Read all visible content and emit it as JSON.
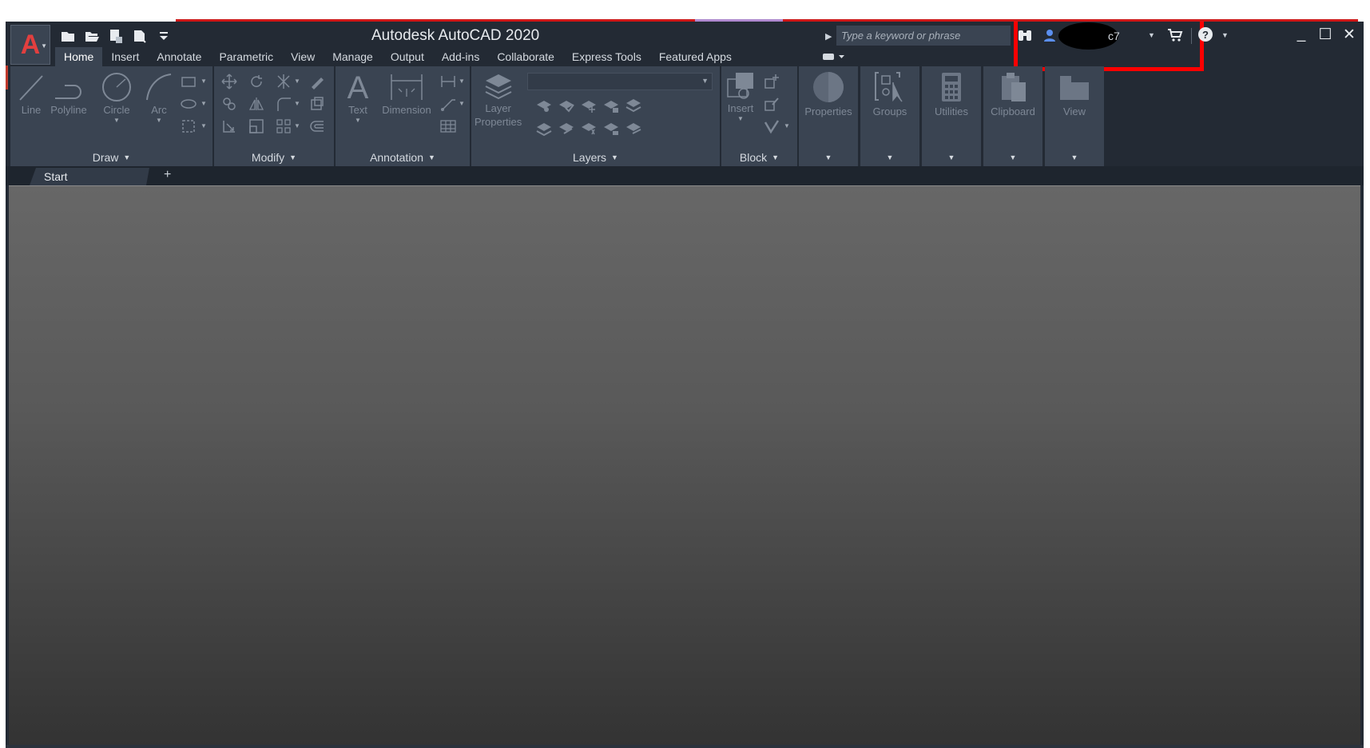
{
  "window": {
    "title": "Autodesk AutoCAD 2020"
  },
  "app_menu": {
    "letter": "A"
  },
  "quick_access": [
    "new-icon",
    "open-icon",
    "save-icon",
    "plot-icon",
    "customize-caret-icon"
  ],
  "search": {
    "placeholder": "Type a keyword or phrase"
  },
  "account": {
    "name_suffix": "c7"
  },
  "ribbon_tabs": [
    "Home",
    "Insert",
    "Annotate",
    "Parametric",
    "View",
    "Manage",
    "Output",
    "Add-ins",
    "Collaborate",
    "Express Tools",
    "Featured Apps"
  ],
  "active_tab": "Home",
  "panels": {
    "draw": {
      "title": "Draw",
      "tools": {
        "line": "Line",
        "polyline": "Polyline",
        "circle": "Circle",
        "arc": "Arc"
      }
    },
    "modify": {
      "title": "Modify"
    },
    "annotation": {
      "title": "Annotation",
      "tools": {
        "text": "Text",
        "dimension": "Dimension"
      }
    },
    "layers": {
      "title": "Layers",
      "tools": {
        "layer_properties_1": "Layer",
        "layer_properties_2": "Properties"
      }
    },
    "block": {
      "title": "Block",
      "tools": {
        "insert": "Insert"
      }
    },
    "properties": {
      "title": "Properties"
    },
    "groups": {
      "title": "Groups"
    },
    "utilities": {
      "title": "Utilities"
    },
    "clipboard": {
      "title": "Clipboard"
    },
    "view": {
      "title": "View"
    }
  },
  "file_tabs": [
    {
      "label": "Start"
    }
  ],
  "colors": {
    "highlight_box": "#ff0000",
    "brand": "#e23f3f",
    "background": "#232a34",
    "panel": "#3a4452"
  }
}
